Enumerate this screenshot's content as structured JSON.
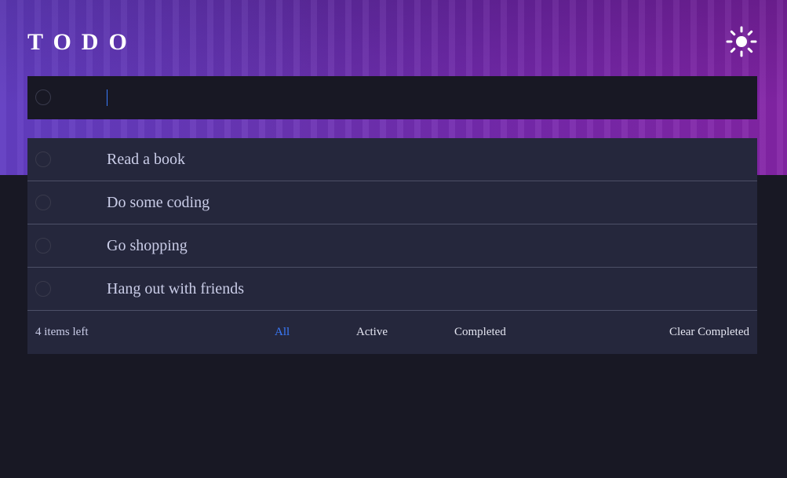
{
  "app": {
    "title": "TODO"
  },
  "new_todo": {
    "value": "",
    "placeholder": ""
  },
  "todos": [
    {
      "text": "Read a book",
      "completed": false
    },
    {
      "text": "Do some coding",
      "completed": false
    },
    {
      "text": "Go shopping",
      "completed": false
    },
    {
      "text": "Hang out with friends",
      "completed": false
    }
  ],
  "footer": {
    "items_left": "4 items left",
    "filters": {
      "all": "All",
      "active": "Active",
      "completed": "Completed"
    },
    "active_filter": "All",
    "clear_completed": "Clear Completed"
  },
  "icons": {
    "theme_toggle": "sun-icon",
    "check": "circle-check-icon"
  },
  "colors": {
    "accent": "#3a7bfd",
    "background": "#181824",
    "card": "#25273c",
    "text": "#cacde8",
    "divider": "#4d5067"
  }
}
